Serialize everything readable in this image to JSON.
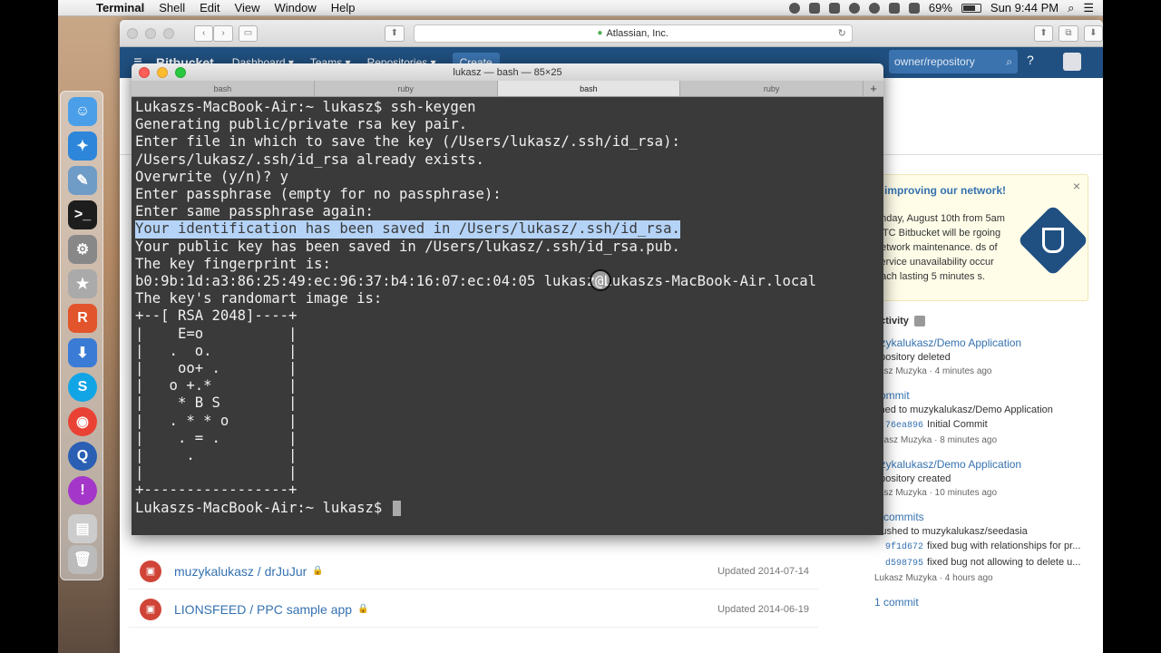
{
  "menubar": {
    "app": "Terminal",
    "items": [
      "Shell",
      "Edit",
      "View",
      "Window",
      "Help"
    ],
    "battery": "69%",
    "clock": "Sun 9:44 PM"
  },
  "browser": {
    "url": "Atlassian, Inc.",
    "bitbucket": {
      "logo": "Bitbucket",
      "nav": [
        "Dashboard ▾",
        "Teams ▾",
        "Repositories ▾"
      ],
      "create": "Create",
      "search_placeholder": "owner/repository"
    },
    "notice": {
      "title": "e improving our network!",
      "text": "unday, August 10th from 5am UTC Bitbucket will be rgoing network maintenance. ds of service unavailability occur each lasting 5 minutes s.",
      "close": "×"
    },
    "feed": {
      "header": "activity",
      "items": [
        {
          "title": "uzykalukasz/Demo Application",
          "desc": "epository deleted",
          "meta": "kasz Muzyka · 4 minutes ago"
        },
        {
          "title": "commit",
          "desc": "shed to muzykalukasz/Demo Application",
          "commits": [
            {
              "hash": "76ea896",
              "msg": "Initial Commit"
            }
          ],
          "meta": "ukasz Muzyka · 8 minutes ago"
        },
        {
          "title": "uzykalukasz/Demo Application",
          "desc": "epository created",
          "meta": "kasz Muzyka · 10 minutes ago"
        },
        {
          "title": "2 commits",
          "desc": "Pushed to muzykalukasz/seedasia",
          "commits": [
            {
              "hash": "9f1d672",
              "msg": "fixed bug with relationships for pr..."
            },
            {
              "hash": "d598795",
              "msg": "fixed bug not allowing to delete u..."
            }
          ],
          "meta": "Lukasz Muzyka · 4 hours ago"
        },
        {
          "title": "1 commit",
          "desc": "",
          "meta": ""
        }
      ]
    },
    "repos": [
      {
        "name": "muzykalukasz / drJuJur",
        "date": "Updated 2014-07-14"
      },
      {
        "name": "LIONSFEED / PPC sample app",
        "date": "Updated 2014-06-19"
      }
    ]
  },
  "terminal": {
    "title": "lukasz — bash — 85×25",
    "tabs": [
      "bash",
      "ruby",
      "bash",
      "ruby"
    ],
    "active_tab": 2,
    "lines": [
      "Lukaszs-MacBook-Air:~ lukasz$ ssh-keygen",
      "Generating public/private rsa key pair.",
      "Enter file in which to save the key (/Users/lukasz/.ssh/id_rsa):",
      "/Users/lukasz/.ssh/id_rsa already exists.",
      "Overwrite (y/n)? y",
      "Enter passphrase (empty for no passphrase):",
      "Enter same passphrase again:",
      "Your identification has been saved in /Users/lukasz/.ssh/id_rsa.",
      "Your public key has been saved in /Users/lukasz/.ssh/id_rsa.pub.",
      "The key fingerprint is:",
      "b0:9b:1d:a3:86:25:49:ec:96:37:b4:16:07:ec:04:05 lukasz@Lukaszs-MacBook-Air.local",
      "The key's randomart image is:",
      "+--[ RSA 2048]----+",
      "|    E=o          |",
      "|   .  o.         |",
      "|    oo+ .        |",
      "|   o +.*         |",
      "|    * B S        |",
      "|   . * * o       |",
      "|    . = .        |",
      "|     .           |",
      "|                 |",
      "+-----------------+",
      "Lukaszs-MacBook-Air:~ lukasz$ "
    ],
    "selected_line": 7
  },
  "colors": {
    "bitbucket_blue": "#205081",
    "link_blue": "#3572b0",
    "terminal_bg": "#3a3a3a",
    "selection": "#b4d3f7"
  }
}
